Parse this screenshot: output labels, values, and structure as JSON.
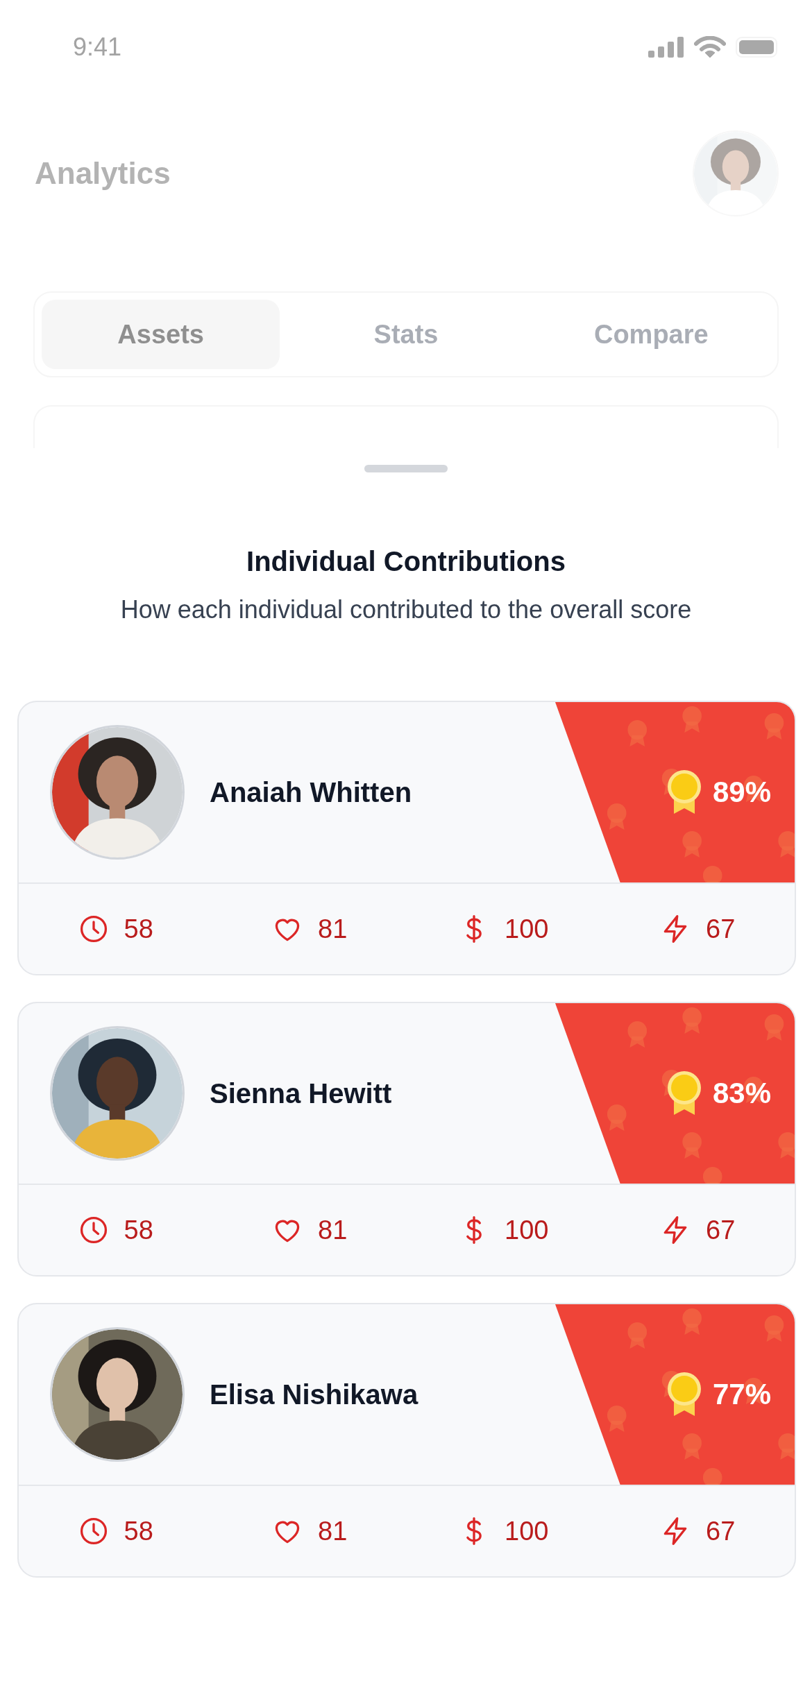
{
  "status_bar": {
    "time": "9:41"
  },
  "header": {
    "title": "Analytics"
  },
  "tabs": [
    {
      "label": "Assets",
      "selected": true
    },
    {
      "label": "Stats",
      "selected": false
    },
    {
      "label": "Compare",
      "selected": false
    }
  ],
  "sheet": {
    "title": "Individual Contributions",
    "subtitle": "How each individual contributed to the overall score"
  },
  "contributors": [
    {
      "name": "Anaiah Whitten",
      "score": "89%",
      "stats": [
        {
          "kind": "time",
          "value": "58"
        },
        {
          "kind": "likes",
          "value": "81"
        },
        {
          "kind": "money",
          "value": "100"
        },
        {
          "kind": "energy",
          "value": "67"
        }
      ]
    },
    {
      "name": "Sienna Hewitt",
      "score": "83%",
      "stats": [
        {
          "kind": "time",
          "value": "58"
        },
        {
          "kind": "likes",
          "value": "81"
        },
        {
          "kind": "money",
          "value": "100"
        },
        {
          "kind": "energy",
          "value": "67"
        }
      ]
    },
    {
      "name": "Elisa Nishikawa",
      "score": "77%",
      "stats": [
        {
          "kind": "time",
          "value": "58"
        },
        {
          "kind": "likes",
          "value": "81"
        },
        {
          "kind": "money",
          "value": "100"
        },
        {
          "kind": "energy",
          "value": "67"
        }
      ]
    }
  ]
}
